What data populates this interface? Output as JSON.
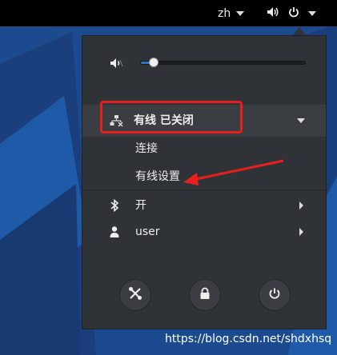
{
  "top_bar": {
    "language": "zh"
  },
  "menu": {
    "volume": {
      "level": 0.05
    },
    "wired": {
      "label": "有线 已关闭",
      "connect_label": "连接",
      "settings_label": "有线设置"
    },
    "bluetooth": {
      "label": "开"
    },
    "user": {
      "label": "user"
    }
  },
  "watermark": "https://blog.csdn.net/shdxhsq",
  "colors": {
    "menu_bg": "#2f3337",
    "highlight_row": "#3a3e43",
    "slider_fill": "#2a76c6",
    "annotation_red": "#e81f1f",
    "top_bar": "#000000"
  },
  "icons": [
    "speaker-icon",
    "power-icon",
    "volume-low-icon",
    "network-wired-icon",
    "bluetooth-icon",
    "user-icon",
    "settings-icon",
    "lock-icon"
  ]
}
